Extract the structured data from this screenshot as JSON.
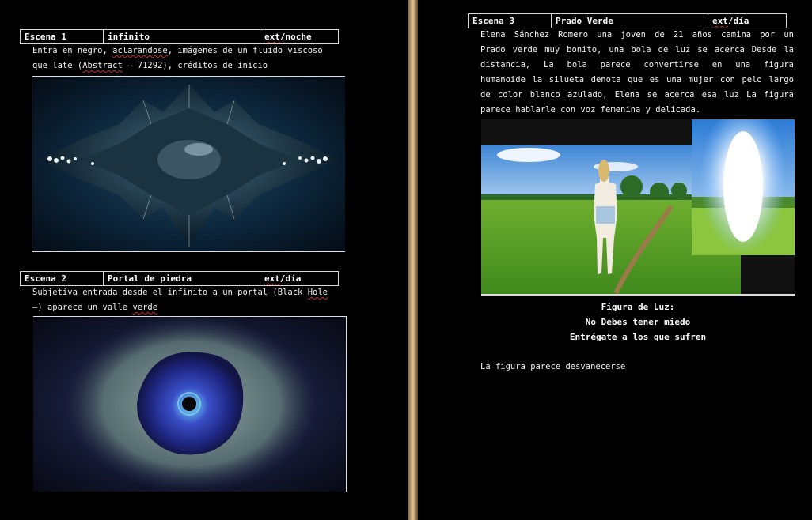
{
  "scene1": {
    "number": "Escena 1",
    "title": "infinito",
    "setting_ext": "ext",
    "setting_rest": "/noche",
    "line1_a": "Entra en negro, ",
    "line1_word": "aclarandose",
    "line1_b": ", imágenes de  un fluido viscoso",
    "line2_a": "que late (",
    "line2_word": "Abstract",
    "line2_b": " – 71292), créditos de inicio"
  },
  "scene2": {
    "number": "Escena 2",
    "title": "Portal de piedra",
    "setting_ext": "ext",
    "setting_rest": "/día",
    "line1_a": "Subjetiva entrada desde el infinito a un portal (Black ",
    "line1_word": "Hole",
    "line2_a": "–) aparece un valle ",
    "line2_word": "verde"
  },
  "scene3": {
    "number": "Escena 3",
    "title": "Prado Verde",
    "setting_ext": "ext",
    "setting_rest": "/día",
    "description_lines": [
      "Elena Sánchez Romero una joven de 21 años camina por un",
      "Prado verde muy bonito, una bola de luz se acerca Desde la",
      "distancia, La bola parece convertirse en una figura",
      "humanoide la silueta denota que es una mujer con pelo largo",
      "de color blanco azulado,  Elena se acerca esa luz La figura",
      "parece hablarle con voz femenina y delicada."
    ],
    "dialogue_character": "Figura de Luz:",
    "dialogue_lines": [
      "No Debes tener miedo",
      "Entrégate a los que sufren"
    ],
    "closing": "La figura parece desvanecerse"
  }
}
